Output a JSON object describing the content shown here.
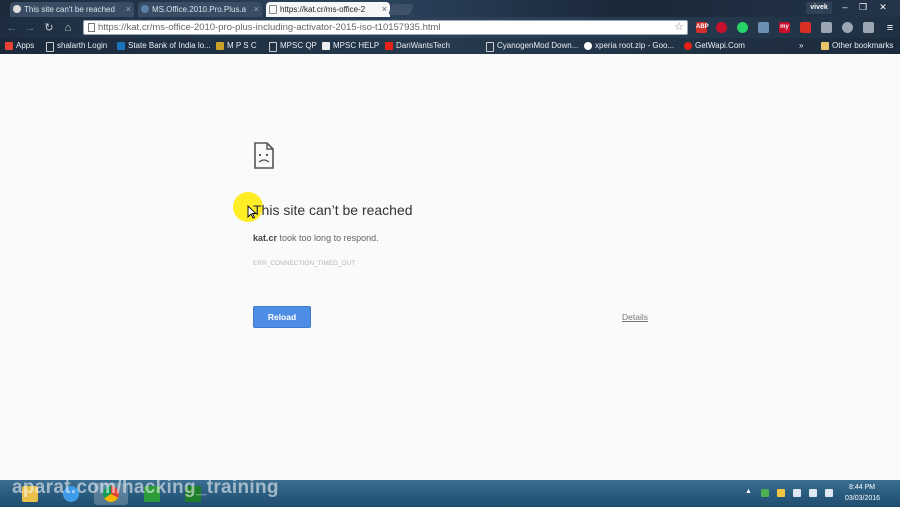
{
  "browser": {
    "tabs": [
      {
        "title": "This site can't be reached",
        "favicon_color": "#dddddd"
      },
      {
        "title": "MS.Office.2010.Pro.Plus.a",
        "favicon_color": "#5b7fa8"
      },
      {
        "title": "https://kat.cr/ms-office-2",
        "favicon_color": "#ffffff"
      }
    ],
    "user": "vivek",
    "window_controls": {
      "minimize": "–",
      "restore": "❐",
      "close": "✕"
    },
    "url": "https://kat.cr/ms-office-2010-pro-plus-including-activator-2015-iso-t10157935.html",
    "nav": {
      "back": "←",
      "forward": "→",
      "reload": "↻",
      "home": "⌂"
    },
    "menu_icon": "≡",
    "extensions": [
      {
        "name": "adblock-icon",
        "color": "#d0312d",
        "label": "ABP"
      },
      {
        "name": "shield-icon",
        "color": "#c8102e",
        "label": ""
      },
      {
        "name": "whatsapp-icon",
        "color": "#25d366",
        "label": ""
      },
      {
        "name": "translate-icon",
        "color": "#6b8fb3",
        "label": ""
      },
      {
        "name": "my-icon",
        "color": "#c8102e",
        "label": "my"
      },
      {
        "name": "gmail-icon",
        "color": "#d93025",
        "label": ""
      },
      {
        "name": "puzzle-icon",
        "color": "#9aa6b2",
        "label": ""
      },
      {
        "name": "sync-icon",
        "color": "#9aa6b2",
        "label": ""
      },
      {
        "name": "cast-icon",
        "color": "#9aa6b2",
        "label": ""
      }
    ],
    "bookmarks": [
      {
        "label": "Apps",
        "color": "#e94235"
      },
      {
        "label": "shalarth Login",
        "color": "#ffffff"
      },
      {
        "label": "State Bank of India lo...",
        "color": "#1c75bc"
      },
      {
        "label": "M P S C",
        "color": "#c9a227"
      },
      {
        "label": "MPSC QP",
        "color": "#ffffff"
      },
      {
        "label": "MPSC HELP",
        "color": "#ffffff"
      },
      {
        "label": "DanWantsTech",
        "color": "#e62117"
      },
      {
        "label": "CyanogenMod Down...",
        "color": "#ffffff"
      },
      {
        "label": "xperia root.zip - Goo...",
        "color": "#ffffff"
      },
      {
        "label": "GetWapi.Com",
        "color": "#e62117"
      }
    ],
    "other_bookmarks": "Other bookmarks",
    "bookmarks_overflow": "»"
  },
  "error": {
    "title": "This site can’t be reached",
    "host": "kat.cr",
    "message": " took too long to respond.",
    "code": "ERR_CONNECTION_TIMED_OUT",
    "reload_label": "Reload",
    "details_label": "Details"
  },
  "taskbar": {
    "watermark": "aparat.com/hacking_training",
    "apps": [
      {
        "name": "explorer",
        "color": "#e8c04a"
      },
      {
        "name": "ie",
        "color": "#3d9be9"
      },
      {
        "name": "chrome",
        "color": "#4caf50"
      },
      {
        "name": "camtasia",
        "color": "#2e9b3a"
      },
      {
        "name": "camtasia-recorder",
        "color": "#1e7d2b"
      }
    ],
    "tray_overflow": "▲",
    "time": "8:44 PM",
    "date": "03/03/2016"
  }
}
